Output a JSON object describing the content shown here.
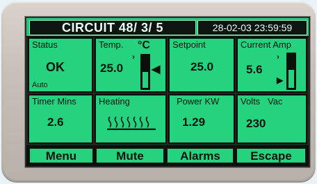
{
  "header": {
    "title": "CIRCUIT  48/ 3/ 5",
    "datetime": "28-02-03  23:59:59"
  },
  "cells": {
    "status": {
      "label": "Status",
      "value": "OK",
      "mode": "Auto"
    },
    "temp": {
      "label": "Temp.",
      "value": "25.0",
      "unit": "°C",
      "level": 0.5
    },
    "setpoint": {
      "label": "Setpoint",
      "value": "25.0"
    },
    "current": {
      "label": "Current Amp",
      "value": "5.6",
      "level": 0.55
    },
    "timer": {
      "label": "Timer Mins",
      "value": "2.6"
    },
    "heating": {
      "label": "Heating"
    },
    "power": {
      "label": "Power KW",
      "value": "1.29"
    },
    "volts": {
      "label": "Volts   Vac",
      "value": "230"
    }
  },
  "softkeys": {
    "menu": "Menu",
    "mute": "Mute",
    "alarms": "Alarms",
    "escape": "Escape"
  },
  "colors": {
    "screen_green": "#25d37f",
    "screen_dark": "#0b100c",
    "bezel": "#c7c0b8"
  },
  "icons": {
    "heating": "heating-waves-icon",
    "temp_pointer": "arrow-left-icon",
    "current_pointer": "arrow-right-icon"
  }
}
